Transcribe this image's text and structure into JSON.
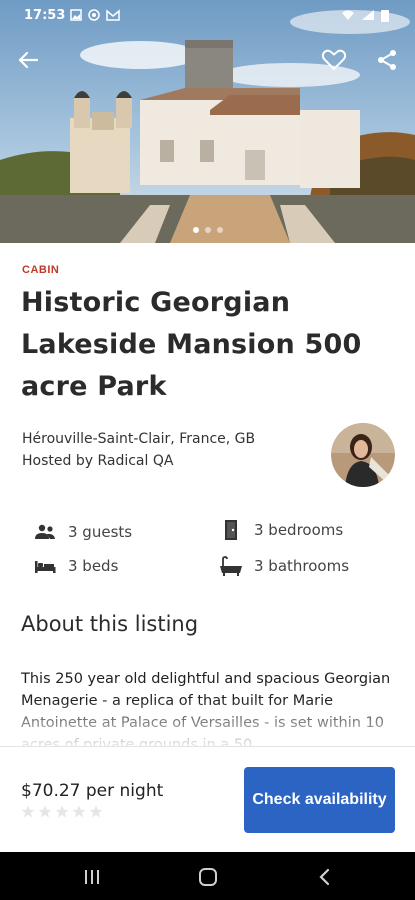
{
  "status_bar": {
    "time": "17:53"
  },
  "listing": {
    "category": "CABIN",
    "title": "Historic Georgian Lakeside Mansion 500 acre Park",
    "location": "Hérouville-Saint-Clair, France, GB",
    "host": "Hosted by Radical QA"
  },
  "amenities": {
    "guests": "3  guests",
    "bedrooms": "3  bedrooms",
    "beds": "3  beds",
    "bathrooms": "3  bathrooms"
  },
  "about": {
    "heading": "About this listing",
    "text": "This 250 year old delightful and spacious Georgian Menagerie - a replica of that built for Marie Antoinette at Palace of Versailles - is set within 10 acres of private grounds in a 50"
  },
  "booking": {
    "price": "$70.27 per night",
    "rating_stars": 0,
    "cta_label": "Check availability"
  },
  "colors": {
    "accent": "#2b64c2",
    "category": "#c0392b"
  },
  "icons": [
    "back-arrow-icon",
    "heart-icon",
    "share-icon",
    "guests-icon",
    "door-icon",
    "bed-icon",
    "bathtub-icon",
    "star-icon"
  ]
}
